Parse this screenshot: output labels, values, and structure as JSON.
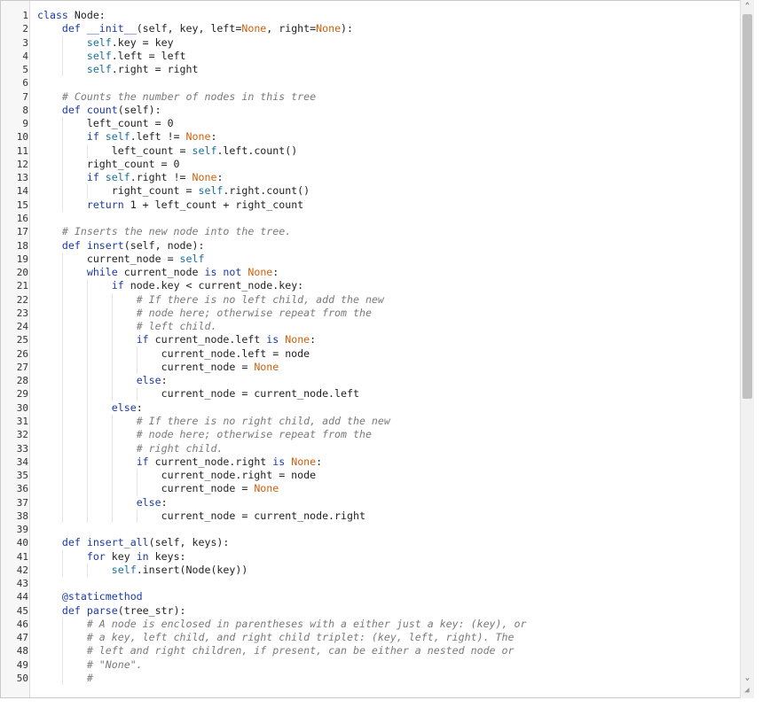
{
  "editor": {
    "lines": [
      [
        [
          "kw",
          "class "
        ],
        [
          "",
          "Node:"
        ]
      ],
      [
        [
          "",
          "    "
        ],
        [
          "kw",
          "def "
        ],
        [
          "fn",
          "__init__"
        ],
        [
          "",
          "(self, key, left="
        ],
        [
          "bi",
          "None"
        ],
        [
          "",
          ", right="
        ],
        [
          "bi",
          "None"
        ],
        [
          "",
          "):"
        ]
      ],
      [
        [
          "",
          "        "
        ],
        [
          "dc",
          "self"
        ],
        [
          "",
          ".key = key"
        ]
      ],
      [
        [
          "",
          "        "
        ],
        [
          "dc",
          "self"
        ],
        [
          "",
          ".left = left"
        ]
      ],
      [
        [
          "",
          "        "
        ],
        [
          "dc",
          "self"
        ],
        [
          "",
          ".right = right"
        ]
      ],
      [
        [
          "",
          ""
        ]
      ],
      [
        [
          "",
          "    "
        ],
        [
          "cm",
          "# Counts the number of nodes in this tree"
        ]
      ],
      [
        [
          "",
          "    "
        ],
        [
          "kw",
          "def "
        ],
        [
          "fn",
          "count"
        ],
        [
          "",
          "(self):"
        ]
      ],
      [
        [
          "",
          "        left_count = 0"
        ]
      ],
      [
        [
          "",
          "        "
        ],
        [
          "kw",
          "if "
        ],
        [
          "dc",
          "self"
        ],
        [
          "",
          ".left != "
        ],
        [
          "bi",
          "None"
        ],
        [
          "",
          ":"
        ]
      ],
      [
        [
          "",
          "            left_count = "
        ],
        [
          "dc",
          "self"
        ],
        [
          "",
          ".left.count()"
        ]
      ],
      [
        [
          "",
          "        right_count = 0"
        ]
      ],
      [
        [
          "",
          "        "
        ],
        [
          "kw",
          "if "
        ],
        [
          "dc",
          "self"
        ],
        [
          "",
          ".right != "
        ],
        [
          "bi",
          "None"
        ],
        [
          "",
          ":"
        ]
      ],
      [
        [
          "",
          "            right_count = "
        ],
        [
          "dc",
          "self"
        ],
        [
          "",
          ".right.count()"
        ]
      ],
      [
        [
          "",
          "        "
        ],
        [
          "kw",
          "return "
        ],
        [
          "",
          "1 + left_count + right_count"
        ]
      ],
      [
        [
          "",
          ""
        ]
      ],
      [
        [
          "",
          "    "
        ],
        [
          "cm",
          "# Inserts the new node into the tree."
        ]
      ],
      [
        [
          "",
          "    "
        ],
        [
          "kw",
          "def "
        ],
        [
          "fn",
          "insert"
        ],
        [
          "",
          "(self, node):"
        ]
      ],
      [
        [
          "",
          "        current_node = "
        ],
        [
          "dc",
          "self"
        ]
      ],
      [
        [
          "",
          "        "
        ],
        [
          "kw",
          "while "
        ],
        [
          "",
          "current_node "
        ],
        [
          "kw",
          "is not "
        ],
        [
          "bi",
          "None"
        ],
        [
          "",
          ":"
        ]
      ],
      [
        [
          "",
          "            "
        ],
        [
          "kw",
          "if "
        ],
        [
          "",
          "node.key < current_node.key:"
        ]
      ],
      [
        [
          "",
          "                "
        ],
        [
          "cm",
          "# If there is no left child, add the new"
        ]
      ],
      [
        [
          "",
          "                "
        ],
        [
          "cm",
          "# node here; otherwise repeat from the"
        ]
      ],
      [
        [
          "",
          "                "
        ],
        [
          "cm",
          "# left child."
        ]
      ],
      [
        [
          "",
          "                "
        ],
        [
          "kw",
          "if "
        ],
        [
          "",
          "current_node.left "
        ],
        [
          "kw",
          "is "
        ],
        [
          "bi",
          "None"
        ],
        [
          "",
          ":"
        ]
      ],
      [
        [
          "",
          "                    current_node.left = node"
        ]
      ],
      [
        [
          "",
          "                    current_node = "
        ],
        [
          "bi",
          "None"
        ]
      ],
      [
        [
          "",
          "                "
        ],
        [
          "kw",
          "else"
        ],
        [
          "",
          ":"
        ]
      ],
      [
        [
          "",
          "                    current_node = current_node.left"
        ]
      ],
      [
        [
          "",
          "            "
        ],
        [
          "kw",
          "else"
        ],
        [
          "",
          ":"
        ]
      ],
      [
        [
          "",
          "                "
        ],
        [
          "cm",
          "# If there is no right child, add the new"
        ]
      ],
      [
        [
          "",
          "                "
        ],
        [
          "cm",
          "# node here; otherwise repeat from the"
        ]
      ],
      [
        [
          "",
          "                "
        ],
        [
          "cm",
          "# right child."
        ]
      ],
      [
        [
          "",
          "                "
        ],
        [
          "kw",
          "if "
        ],
        [
          "",
          "current_node.right "
        ],
        [
          "kw",
          "is "
        ],
        [
          "bi",
          "None"
        ],
        [
          "",
          ":"
        ]
      ],
      [
        [
          "",
          "                    current_node.right = node"
        ]
      ],
      [
        [
          "",
          "                    current_node = "
        ],
        [
          "bi",
          "None"
        ]
      ],
      [
        [
          "",
          "                "
        ],
        [
          "kw",
          "else"
        ],
        [
          "",
          ":"
        ]
      ],
      [
        [
          "",
          "                    current_node = current_node.right"
        ]
      ],
      [
        [
          "",
          ""
        ]
      ],
      [
        [
          "",
          "    "
        ],
        [
          "kw",
          "def "
        ],
        [
          "fn",
          "insert_all"
        ],
        [
          "",
          "(self, keys):"
        ]
      ],
      [
        [
          "",
          "        "
        ],
        [
          "kw",
          "for "
        ],
        [
          "",
          "key "
        ],
        [
          "kw",
          "in "
        ],
        [
          "",
          "keys:"
        ]
      ],
      [
        [
          "",
          "            "
        ],
        [
          "dc",
          "self"
        ],
        [
          "",
          ".insert(Node(key))"
        ]
      ],
      [
        [
          "",
          ""
        ]
      ],
      [
        [
          "",
          "    "
        ],
        [
          "at",
          "@staticmethod"
        ]
      ],
      [
        [
          "",
          "    "
        ],
        [
          "kw",
          "def "
        ],
        [
          "fn",
          "parse"
        ],
        [
          "",
          "(tree_str):"
        ]
      ],
      [
        [
          "",
          "        "
        ],
        [
          "cm",
          "# A node is enclosed in parentheses with a either just a key: (key), or"
        ]
      ],
      [
        [
          "",
          "        "
        ],
        [
          "cm",
          "# a key, left child, and right child triplet: (key, left, right). The"
        ]
      ],
      [
        [
          "",
          "        "
        ],
        [
          "cm",
          "# left and right children, if present, can be either a nested node or"
        ]
      ],
      [
        [
          "",
          "        "
        ],
        [
          "cm",
          "# \"None\"."
        ]
      ],
      [
        [
          "",
          "        "
        ],
        [
          "cm",
          "#"
        ]
      ]
    ]
  },
  "scrollbar": {
    "up_icon": "chevron-up-icon",
    "down_icon": "chevron-down-icon",
    "up_glyph": "⌃",
    "down_glyph": "⌄"
  },
  "resize_glyph": "◢"
}
